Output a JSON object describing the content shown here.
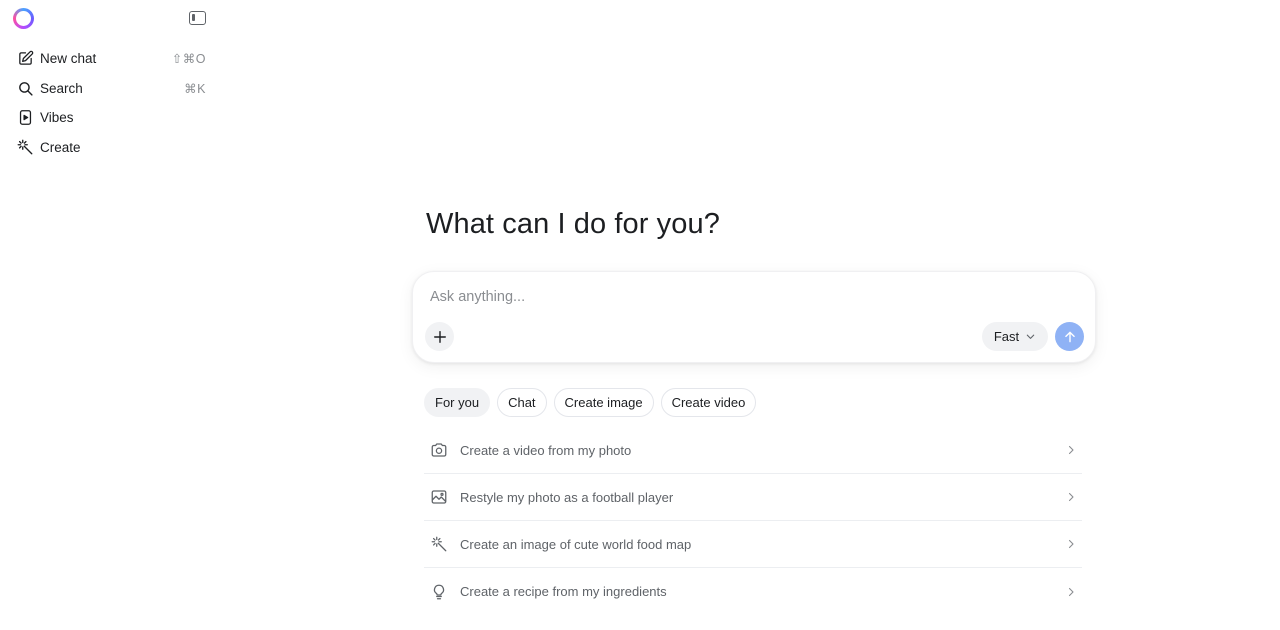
{
  "sidebar": {
    "logo": "meta-ai-ring-logo",
    "toggle_icon": "sidebar-toggle-icon",
    "items": [
      {
        "label": "New chat",
        "shortcut": "⇧⌘O",
        "icon": "edit-icon"
      },
      {
        "label": "Search",
        "shortcut": "⌘K",
        "icon": "search-icon"
      },
      {
        "label": "Vibes",
        "shortcut": "",
        "icon": "play-square-icon"
      },
      {
        "label": "Create",
        "shortcut": "",
        "icon": "magic-wand-icon"
      }
    ]
  },
  "main": {
    "heading": "What can I do for you?",
    "composer": {
      "placeholder": "Ask anything...",
      "mode": "Fast",
      "send_color": "#8fb2f5"
    },
    "chips": [
      {
        "label": "For you",
        "active": true
      },
      {
        "label": "Chat",
        "active": false
      },
      {
        "label": "Create image",
        "active": false
      },
      {
        "label": "Create video",
        "active": false
      }
    ],
    "suggestions": [
      {
        "text": "Create a video from my photo",
        "icon": "camera-icon"
      },
      {
        "text": "Restyle my photo as a football player",
        "icon": "image-icon"
      },
      {
        "text": "Create an image of cute world food map",
        "icon": "magic-wand-icon"
      },
      {
        "text": "Create a recipe from my ingredients",
        "icon": "lightbulb-icon"
      }
    ]
  }
}
